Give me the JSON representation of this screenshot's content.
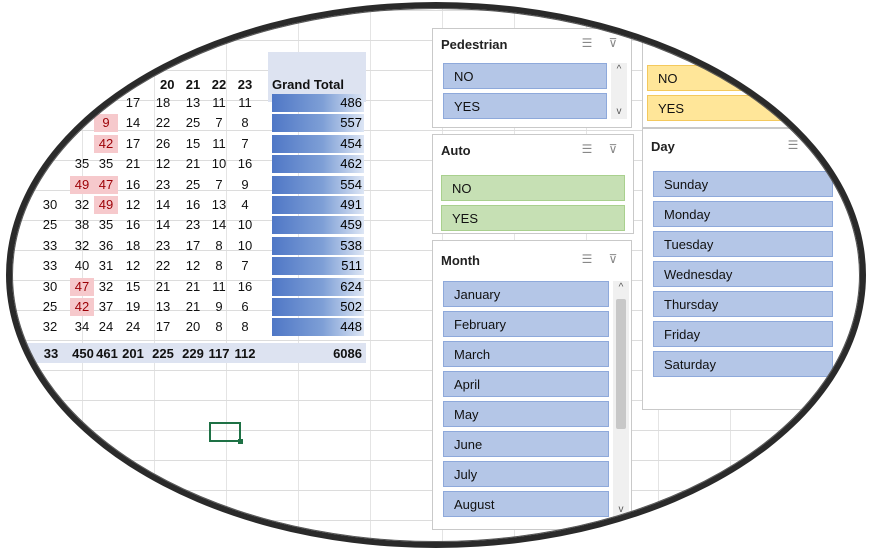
{
  "pivot": {
    "header_cols": [
      "20",
      "21",
      "22",
      "23"
    ],
    "grand_total_label": "Grand Total",
    "rows": [
      {
        "c": [
          "",
          "",
          "17",
          "18",
          "13",
          "11",
          "11"
        ],
        "gt": "486"
      },
      {
        "c": [
          "",
          "9",
          "14",
          "22",
          "25",
          "7",
          "8"
        ],
        "gt": "557"
      },
      {
        "c": [
          "",
          "42",
          "17",
          "26",
          "15",
          "11",
          "7"
        ],
        "gt": "454"
      },
      {
        "c": [
          "35",
          "35",
          "21",
          "12",
          "21",
          "10",
          "16"
        ],
        "gt": "462"
      },
      {
        "c": [
          "49",
          "47",
          "16",
          "23",
          "25",
          "7",
          "9"
        ],
        "gt": "554"
      },
      {
        "c": [
          "32",
          "49",
          "12",
          "14",
          "16",
          "13",
          "4"
        ],
        "gt": "491"
      },
      {
        "c": [
          "38",
          "35",
          "16",
          "14",
          "23",
          "14",
          "10"
        ],
        "gt": "459"
      },
      {
        "c": [
          "32",
          "36",
          "18",
          "23",
          "17",
          "8",
          "10"
        ],
        "gt": "538"
      },
      {
        "c": [
          "40",
          "31",
          "12",
          "22",
          "12",
          "8",
          "7"
        ],
        "gt": "511"
      },
      {
        "c": [
          "47",
          "32",
          "15",
          "21",
          "21",
          "11",
          "16"
        ],
        "gt": "624"
      },
      {
        "c": [
          "42",
          "37",
          "19",
          "13",
          "21",
          "9",
          "6"
        ],
        "gt": "502"
      },
      {
        "c": [
          "34",
          "24",
          "24",
          "17",
          "20",
          "8",
          "8"
        ],
        "gt": "448"
      }
    ],
    "left_edge_values": [
      "",
      "",
      "",
      "",
      "",
      "30",
      "25",
      "33",
      "33",
      "30",
      "25",
      "32"
    ],
    "totals": {
      "c": [
        "450",
        "461",
        "201",
        "225",
        "229",
        "117",
        "112"
      ],
      "edge": "33",
      "gt": "6086"
    }
  },
  "slicers": {
    "pedestrian": {
      "title": "Pedestrian",
      "items": [
        "NO",
        "YES"
      ]
    },
    "unnamed": {
      "items": [
        "NO",
        "YES"
      ]
    },
    "auto": {
      "title": "Auto",
      "items": [
        "NO",
        "YES"
      ]
    },
    "day": {
      "title": "Day",
      "items": [
        "Sunday",
        "Monday",
        "Tuesday",
        "Wednesday",
        "Thursday",
        "Friday",
        "Saturday"
      ]
    },
    "month": {
      "title": "Month",
      "items": [
        "January",
        "February",
        "March",
        "April",
        "May",
        "June",
        "July",
        "August"
      ]
    }
  },
  "icons": {
    "multi_select": "multi-select-icon",
    "clear_filter": "clear-filter-icon"
  }
}
